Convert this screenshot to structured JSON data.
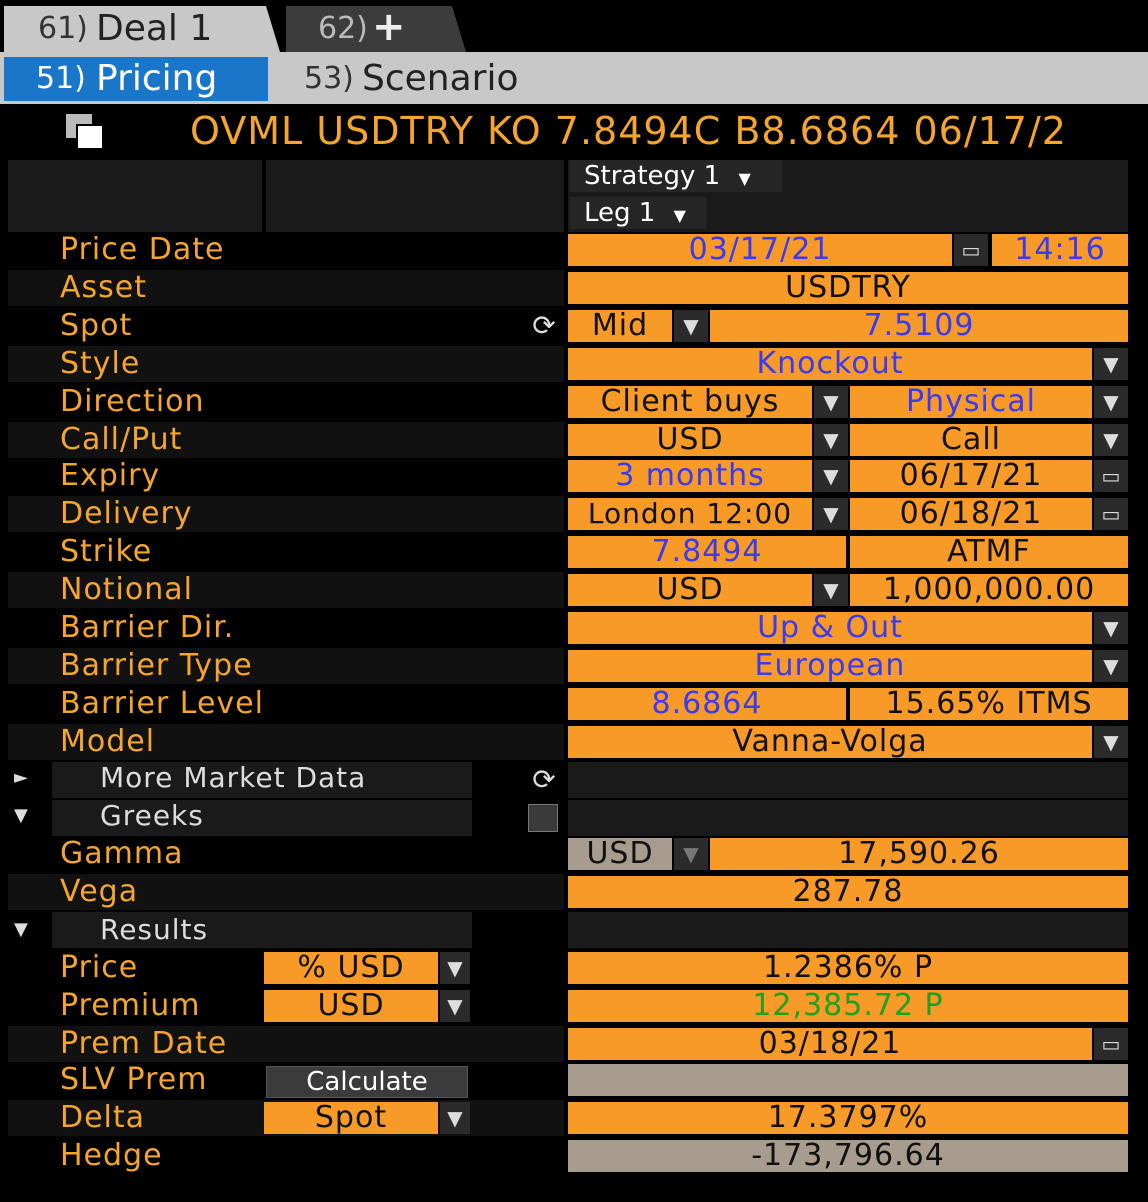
{
  "tabs": {
    "deal1": {
      "num": "61)",
      "label": "Deal 1"
    },
    "deal2": {
      "num": "62)",
      "label": "+"
    }
  },
  "subtabs": {
    "pricing": {
      "num": "51)",
      "label": "Pricing"
    },
    "scenario": {
      "num": "53)",
      "label": "Scenario"
    }
  },
  "title": "OVML USDTRY KO 7.8494C B8.6864 06/17/2",
  "strategy": "Strategy 1",
  "leg": "Leg 1",
  "labels": {
    "price_date": "Price Date",
    "asset": "Asset",
    "spot": "Spot",
    "style": "Style",
    "direction": "Direction",
    "callput": "Call/Put",
    "expiry": "Expiry",
    "delivery": "Delivery",
    "strike": "Strike",
    "notional": "Notional",
    "barrier_dir": "Barrier Dir.",
    "barrier_type": "Barrier Type",
    "barrier_level": "Barrier Level",
    "model": "Model",
    "more_market_data": "More Market Data",
    "greeks": "Greeks",
    "gamma": "Gamma",
    "vega": "Vega",
    "results": "Results",
    "price": "Price",
    "premium": "Premium",
    "prem_date": "Prem Date",
    "slv_prem": "SLV Prem",
    "delta": "Delta",
    "hedge": "Hedge"
  },
  "values": {
    "price_date": "03/17/21",
    "price_time": "14:16",
    "asset": "USDTRY",
    "spot_side": "Mid",
    "spot": "7.5109",
    "style": "Knockout",
    "direction": "Client buys",
    "settlement": "Physical",
    "callput_ccy": "USD",
    "callput": "Call",
    "expiry_tenor": "3 months",
    "expiry_date": "06/17/21",
    "delivery_cut": "London 12:00",
    "delivery_date": "06/18/21",
    "strike": "7.8494",
    "strike_ref": "ATMF",
    "notional_ccy": "USD",
    "notional": "1,000,000.00",
    "barrier_dir": "Up & Out",
    "barrier_type": "European",
    "barrier_level": "8.6864",
    "barrier_pct": "15.65% ITMS",
    "model": "Vanna-Volga",
    "gamma_ccy": "USD",
    "gamma": "17,590.26",
    "vega": "287.78",
    "price_unit": "% USD",
    "price": "1.2386% P",
    "premium_ccy": "USD",
    "premium": "12,385.72 P",
    "prem_date": "03/18/21",
    "slv_button": "Calculate",
    "slv_prem": "",
    "delta_type": "Spot",
    "delta": "17.3797%",
    "hedge": "-173,796.64"
  },
  "colors": {
    "accent": "#f79a27",
    "blue_text": "#3a3af0",
    "green_text": "#1fa01f",
    "selected_tab": "#1976c8"
  }
}
